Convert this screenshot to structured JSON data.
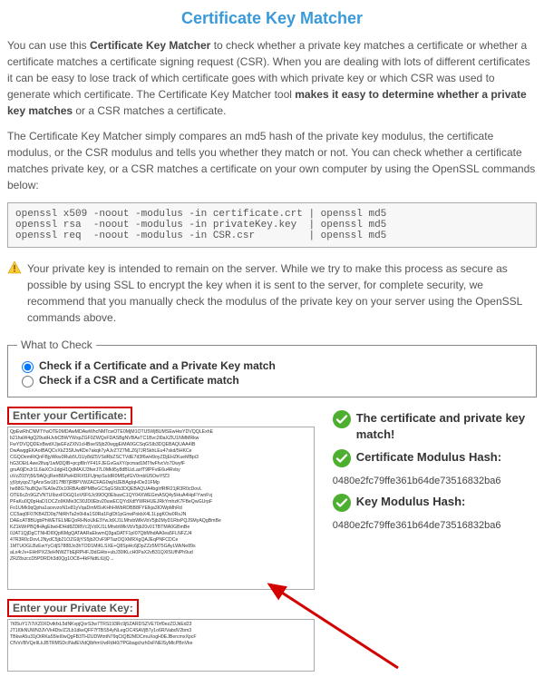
{
  "title": "Certificate Key Matcher",
  "intro_plain1": "You can use this ",
  "intro_bold1": "Certificate Key Matcher",
  "intro_plain2": " to check whether a private key matches a certificate or whether a certificate matches a certificate signing request (CSR). When you are dealing with lots of different certificates it can be easy to lose track of which certificate goes with which private key or which CSR was used to generate which certificate. The Certificate Key Matcher tool ",
  "intro_bold2": "makes it easy to determine whether a private key matches",
  "intro_plain3": " or a CSR matches a certificate.",
  "para2": "The Certificate Key Matcher simply compares an md5 hash of the private key modulus, the certificate modulus, or the CSR modulus and tells you whether they match or not. You can check whether a certificate matches private key, or a CSR matches a certificate on your own computer by using the OpenSSL commands below:",
  "commands": "openssl x509 -noout -modulus -in certificate.crt | openssl md5\nopenssl rsa  -noout -modulus -in privateKey.key  | openssl md5\nopenssl req  -noout -modulus -in CSR.csr         | openssl md5",
  "warning": "Your private key is intended to remain on the server. While we try to make this process as secure as possible by using SSL to encrypt the key when it is sent to the server, for complete security, we recommend that you manually check the modulus of the private key on your server using the OpenSSL commands above.",
  "fieldset_legend": "What to Check",
  "radio1": "Check if a Certificate and a Private Key match",
  "radio2": "Check if a CSR and a Certificate match",
  "cert_label": "Enter your Certificate:",
  "key_label": "Enter your Private Key:",
  "cert_text": "QpEwRhCNMTYwOTE0MDAwMDAwWhcNMTcwOTE0MjM1OTU5WjBUMSEwHwYDVQQLExhE\nb21haW4gQ29udHJvbCBWYWxpZGF0ZWQxFDASBgNVBAsTC1Bvc2l0aXZlU1NMMRkw\nFwYDVQQDExBwdXJjaGFzZXN1cHBseS5jb20wggEiMA0GCSqGSIb3DQEBAQUAA4IB\nDwAwggEKAoIBAQCvXkZ3SlUwKDe7akqk7yAJvZ7Z7MLZ6j7JRSkhLEu47skd/5HKCe\nCGQOemRtQnFBjyWkw3Rub5U1Uy8dZ5VSdRbZSCTVdE7d3f6wH9oyZDjEHZKueMBpi3\nhG3OEtL4we2lfuq/1wM3QlB+pcpf8nYF41FJEGvGaXY/pcmad1MTfwFfvcVo7DwyfF\ngruA0jDnJr1L6iaXCn1dgH1QdMAXJ3fwrJ7L0Mkli5y8dBUzLaxfT9lPFvtE6u4Rvby\nuVzZ03Yj56/9AQcjRenB6PwHDRXf1FUjmpSuIdR0Mf1pfGV0rnblU5OwYfZ3\nyjVpiyqoZ7gAnxSw1817ff87jRBPVWZACFAG0wj/dJEBAgIqHOe31FMp\nhe88G7kuBQw7EA9eZ0c10RBAoBPMBeGCSqGSIb3DQEBAQUA4bgIrfRfR21jR3R0cDovL\nOTE6cZn9GZVNTUIbzxFDGQ1oV6F6Jc99OQ0EbuwC1QY04XWEGmASQ4y5HuA4HpFYwnFvj\nPFaKu0Q0pHaD1OCZo9KMle3C90JD0Ebv20uwECQYdXdfYWRHUEJRkYmhzK7FBeQwGUrpF\nFo1UMk9qQpha1acevzoN1e81yVqaDmMSvKHhHWbRDBB8FYElkja3IOWpMhRd\nCC5aq0F07KB4ZD0q7NtRhTa2n0HIa1S0Ra1FglDt1pGnwPokbX4L1LpgKOw0RsJN\nDAEcAT8BUgbPhWETELMEQoRHNoUkE3YwJdXJ1LMhvbWlkVbV5jb2MyD1RtxPQJSMyAQgBmBe\nKZ1kWrPBQfHAgEbwHDHd8ZDl8Vc2jVdXJ1LMhvbWlkVbV5jb20v01TBTMA0GBmBe\n0JAT1QjDgCTNHDI0Qpl6MgQATAARaEkwmQ3gaDATF1pI07QbMhdAA0ea5FLNFZJ4\n47R3R0cDovL2NydC5jb21OZG9jYS5jb2OvF9PTazOQXMRXgQAJEqPNFCDCe\n1MTUOGLBzEwYyCdjS7888Jo3hTOD1MiKLSXE+Q8SpHc6jDpZZz5M75GAyLWkNe89s\naLx4rJv+EHrlPX23eHNWZTbEjRPHFJ3dGHtx+ubJ30lKLcH0PaX2vB31QXlSUfNPh9ud\nZRZ8xzccD5PDRDh3d0Qg1OC8+4kFNdtLtUjQ→",
  "key_text": "7t05uY17i7iXZ0XDvtkfxL5dNKvpjQorS3w7TRS193Rc9j5ZARDSZVE70rf0ezZDJkEd23\nJT1I0kNUWN3JVVk4Dtv/Z2Lb1dkeQFF7fTBS54yNLegOC4SAVjB7y1o6R/VabdV2bm3\nTBkwA5u31jOtRKa55leI0wQgFB3TH2UDWtntN79qCtQB2MDCmuXogH0EJBercmxXpcF\nCfVsVBVQeIlLkJBTRMSDc/NafEVldQlbfrmVwRdH0/7PGbagchzh0sFNElSyMlcPBnVke",
  "result_msg": "The certificate and private key match!",
  "cert_hash_label": "Certificate Modulus Hash:",
  "cert_hash": "0480e2fc79ffe361b64de73516832ba6",
  "key_hash_label": "Key Modulus Hash:",
  "key_hash": "0480e2fc79ffe361b64de73516832ba6"
}
